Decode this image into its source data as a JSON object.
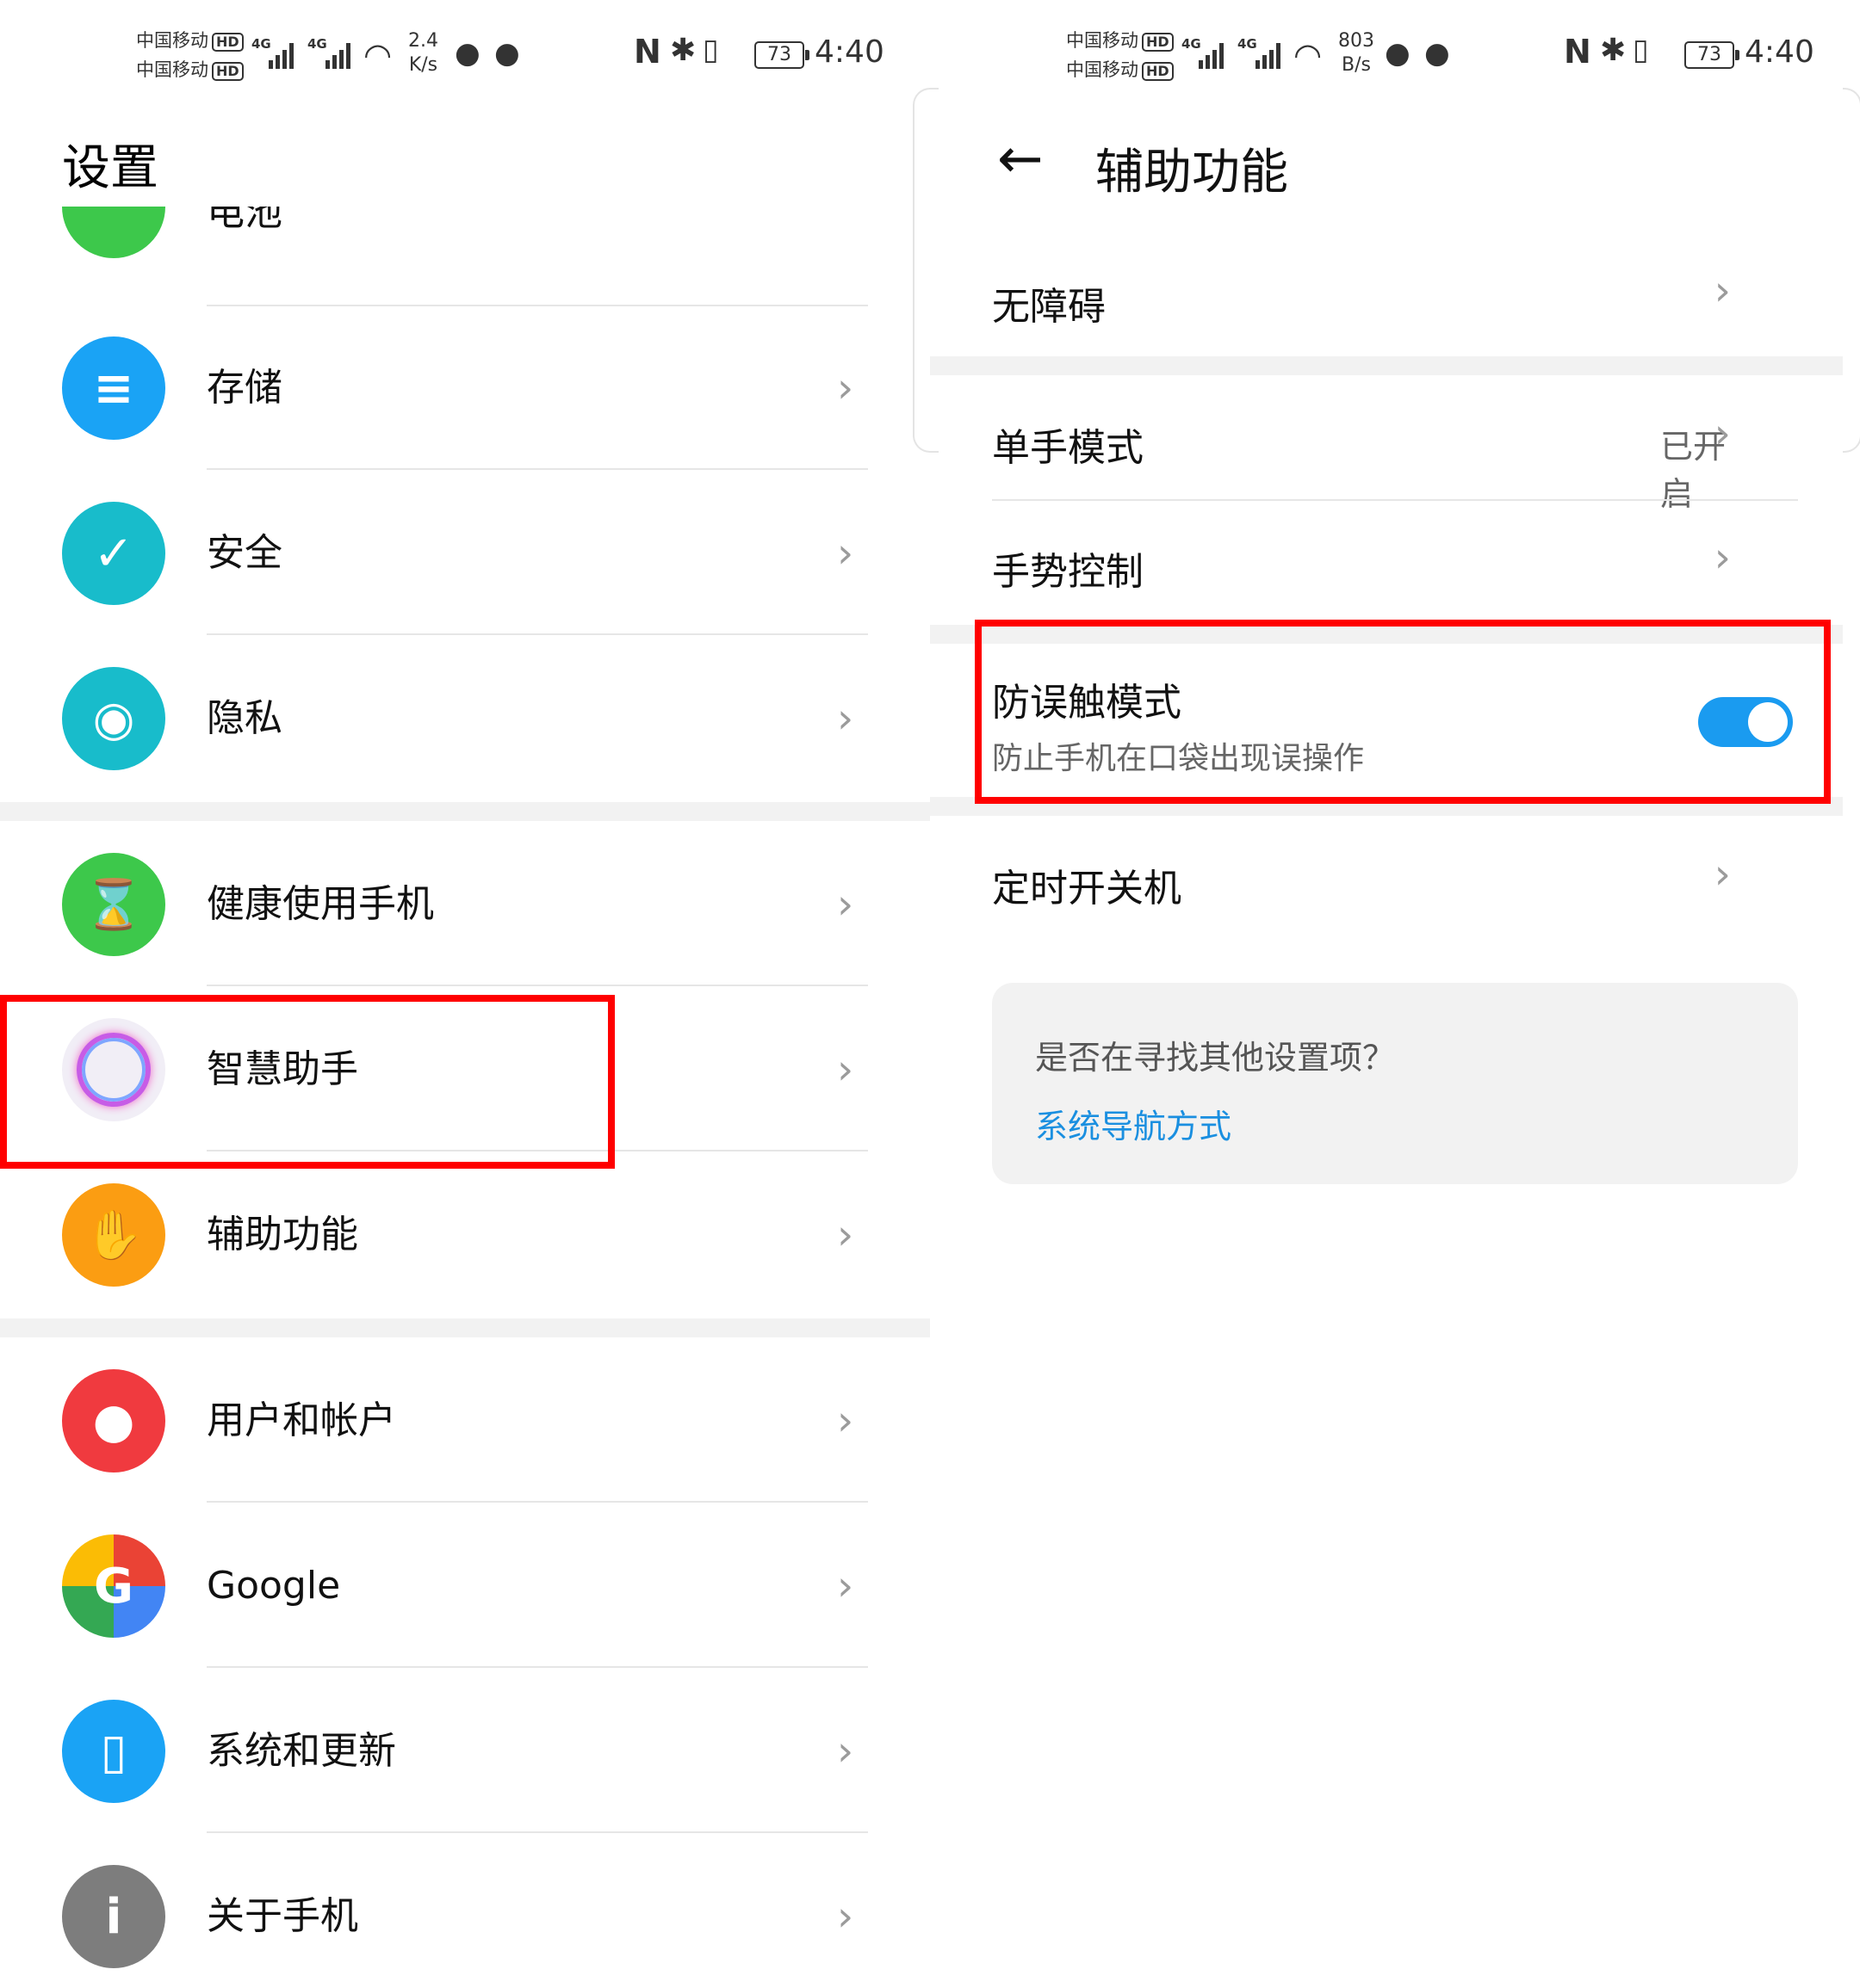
{
  "status_bar": {
    "carrier_1": "中国移动",
    "carrier_2": "中国移动",
    "hd_badge": "HD",
    "network_1": "4G",
    "network_2": "4G",
    "left_speed_value": "2.4",
    "left_speed_unit": "K/s",
    "right_speed_value": "803",
    "right_speed_unit": "B/s",
    "battery": "73",
    "time": "4:40"
  },
  "left": {
    "title": "设置",
    "partial_item_label": "电池",
    "items": [
      {
        "label": "存储",
        "icon": "storage-icon",
        "color": "#1aa3f5"
      },
      {
        "label": "安全",
        "icon": "security-shield-icon",
        "color": "#18bccb"
      },
      {
        "label": "隐私",
        "icon": "privacy-shield-icon",
        "color": "#18bccb"
      },
      {
        "label": "健康使用手机",
        "icon": "hourglass-icon",
        "color": "#3dc84b"
      },
      {
        "label": "智慧助手",
        "icon": "assistant-orb-icon",
        "color": "#f1eef6"
      },
      {
        "label": "辅助功能",
        "icon": "hand-icon",
        "color": "#fb9d12"
      },
      {
        "label": "用户和帐户",
        "icon": "user-icon",
        "color": "#f03a3f"
      },
      {
        "label": "Google",
        "icon": "google-icon",
        "color": "#4285f4"
      },
      {
        "label": "系统和更新",
        "icon": "system-update-icon",
        "color": "#1aa3f5"
      },
      {
        "label": "关于手机",
        "icon": "about-phone-icon",
        "color": "#7d7d7d"
      }
    ]
  },
  "right": {
    "back_icon": "back-arrow-icon",
    "title": "辅助功能",
    "items": {
      "accessibility": "无障碍",
      "one_hand": "单手模式",
      "one_hand_value": "已开启",
      "gesture": "手势控制",
      "pocket_mode": "防误触模式",
      "pocket_mode_desc": "防止手机在口袋出现误操作",
      "scheduled_power": "定时开关机"
    },
    "toggle_on": true,
    "suggest": {
      "question": "是否在寻找其他设置项？",
      "link": "系统导航方式"
    },
    "accent": "#1a9bf0"
  },
  "highlight_color": "#ff0000"
}
